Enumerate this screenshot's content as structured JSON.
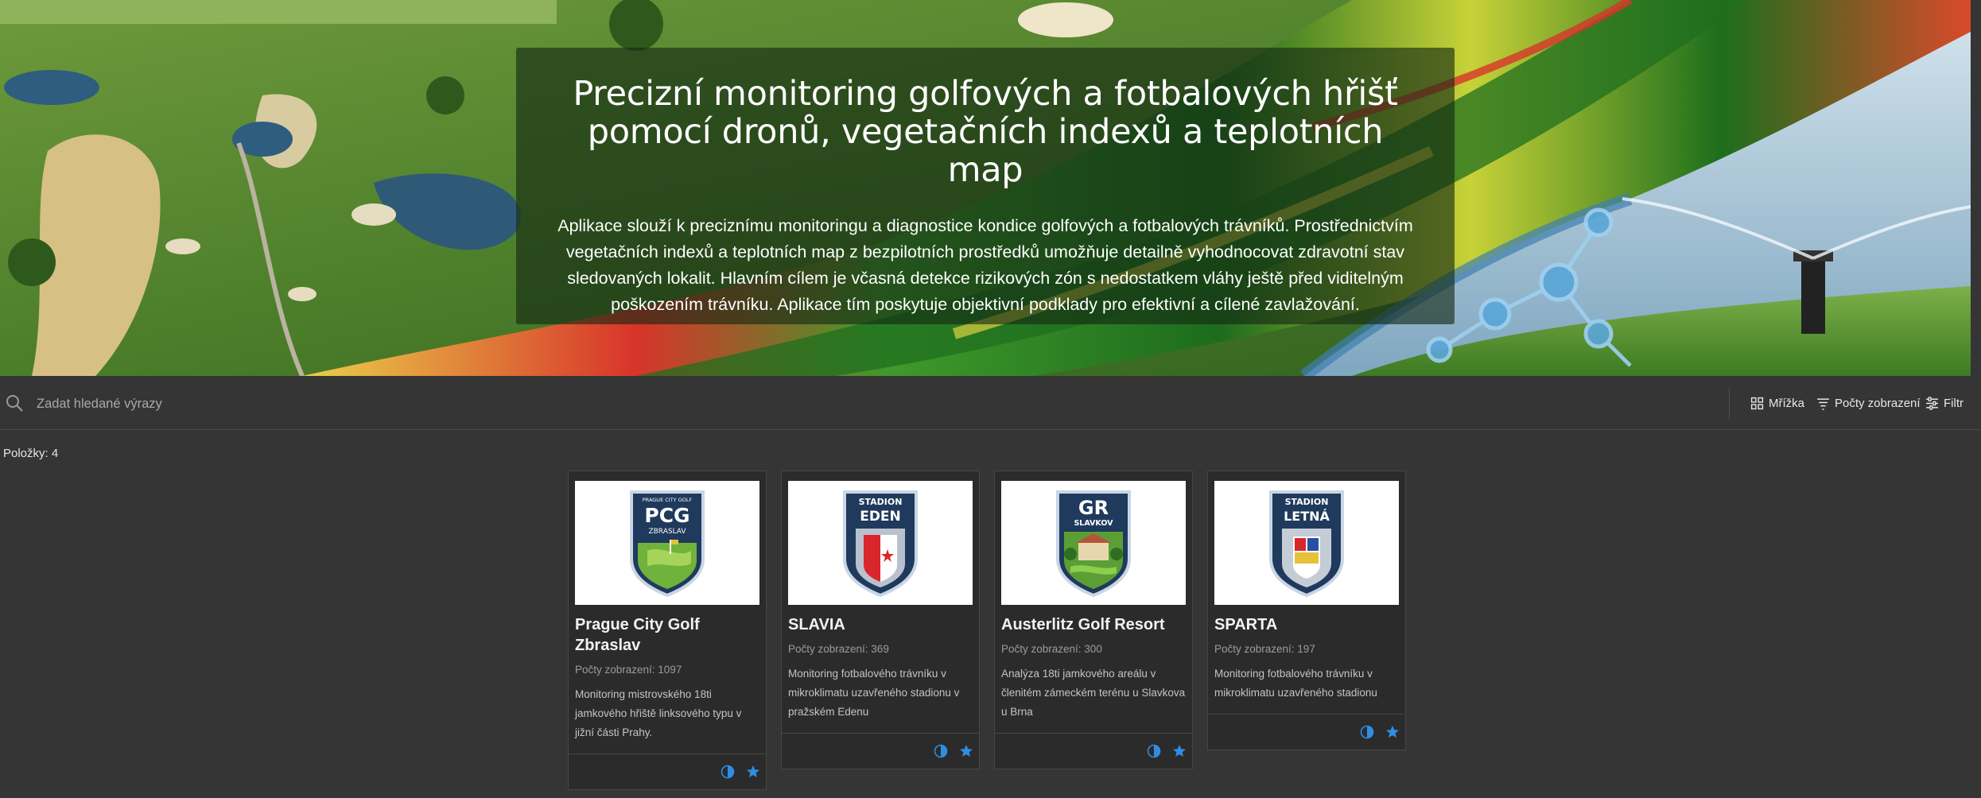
{
  "hero": {
    "title": "Precizní monitoring golfových a fotbalových hřišť pomocí dronů, vegetačních indexů a teplotních map",
    "description": "Aplikace slouží k preciznímu monitoringu a diagnostice kondice golfových a fotbalových trávníků. Prostřednictvím vegetačních indexů a teplotních map z bezpilotních prostředků umožňuje detailně vyhodnocovat zdravotní stav sledovaných lokalit. Hlavním cílem je včasná detekce rizikových zón s nedostatkem vláhy ještě před viditelným poškozením trávníku. Aplikace tím poskytuje objektivní podklady pro efektivní a cílené zavlažování."
  },
  "toolbar": {
    "search_placeholder": "Zadat hledané výrazy",
    "grid_label": "Mřížka",
    "views_label": "Počty zobrazení",
    "filter_label": "Filtr"
  },
  "items_count": "Položky: 4",
  "cards": [
    {
      "title": "Prague City Golf Zbraslav",
      "views": "Počty zobrazení: 1097",
      "description": "Monitoring mistrovského 18ti jamkového hřiště linksového typu v jižní části Prahy.",
      "logo_top": "PRAGUE CITY GOLF",
      "logo_main": "PCG",
      "logo_sub": "ZBRASLAV"
    },
    {
      "title": "SLAVIA",
      "views": "Počty zobrazení: 369",
      "description": "Monitoring fotbalového trávníku v mikroklimatu uzavřeného stadionu v pražském Edenu",
      "logo_main": "STADION",
      "logo_sub": "EDEN"
    },
    {
      "title": "Austerlitz Golf Resort",
      "views": "Počty zobrazení: 300",
      "description": "Analýza 18ti jamkového areálu v členitém zámeckém terénu u Slavkova u Brna",
      "logo_main": "GR",
      "logo_sub": "SLAVKOV"
    },
    {
      "title": "SPARTA",
      "views": "Počty zobrazení: 197",
      "description": "Monitoring fotbalového trávníku v mikroklimatu uzavřeného stadionu",
      "logo_main": "STADION",
      "logo_sub": "LETNÁ"
    }
  ],
  "colors": {
    "background": "#353535",
    "card_bg": "#2b2b2b",
    "accent_blue": "#2f8de4",
    "text": "#e8e8e8"
  },
  "icons": {
    "search": "search-icon",
    "grid": "grid-icon",
    "sort": "sort-icon",
    "filter": "filter-icon",
    "item_type": "web-app-icon",
    "favorite": "star-icon"
  }
}
